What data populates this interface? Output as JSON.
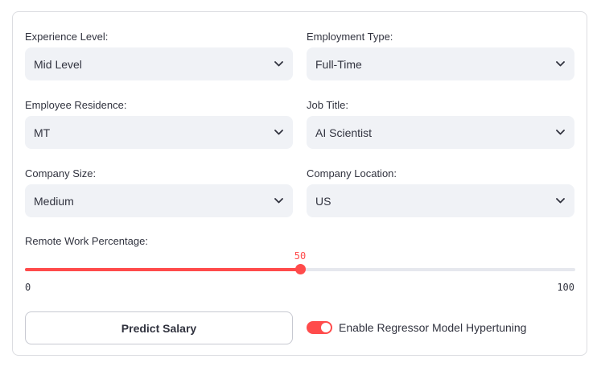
{
  "form": {
    "experience": {
      "label": "Experience Level:",
      "value": "Mid Level"
    },
    "employment": {
      "label": "Employment Type:",
      "value": "Full-Time"
    },
    "residence": {
      "label": "Employee Residence:",
      "value": "MT"
    },
    "job_title": {
      "label": "Job Title:",
      "value": "AI Scientist"
    },
    "company_size": {
      "label": "Company Size:",
      "value": "Medium"
    },
    "company_location": {
      "label": "Company Location:",
      "value": "US"
    },
    "remote": {
      "label": "Remote Work Percentage:",
      "value": 50,
      "value_text": "50",
      "min": 0,
      "min_text": "0",
      "max": 100,
      "max_text": "100"
    }
  },
  "actions": {
    "predict_label": "Predict Salary",
    "toggle_label": "Enable Regressor Model Hypertuning",
    "toggle_on": true
  },
  "colors": {
    "accent": "#ff4b4b",
    "select_bg": "#f0f2f6"
  },
  "icons": {
    "select_chevron": "chevron-down-icon"
  }
}
